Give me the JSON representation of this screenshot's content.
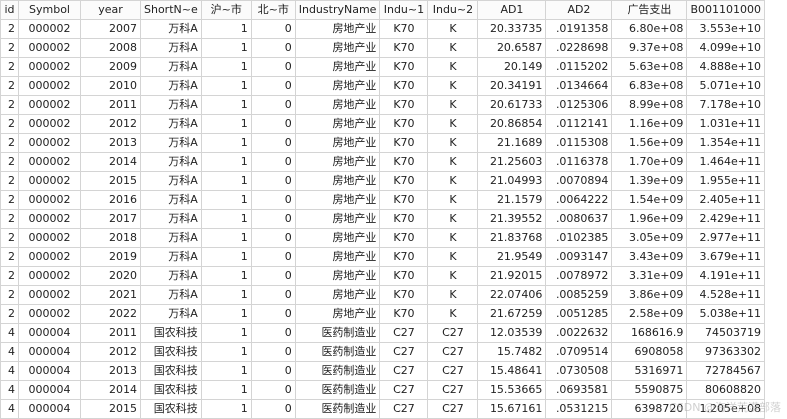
{
  "columns": [
    "id",
    "Symbol",
    "year",
    "ShortN~e",
    "沪~市",
    "北~市",
    "IndustryName",
    "Indu~1",
    "Indu~2",
    "AD1",
    "AD2",
    "广告支出",
    "B001101000"
  ],
  "rows": [
    [
      "2",
      "000002",
      "2007",
      "万科A",
      "1",
      "0",
      "房地产业",
      "K70",
      "K",
      "20.33735",
      ".0191358",
      "6.80e+08",
      "3.553e+10"
    ],
    [
      "2",
      "000002",
      "2008",
      "万科A",
      "1",
      "0",
      "房地产业",
      "K70",
      "K",
      "20.6587",
      ".0228698",
      "9.37e+08",
      "4.099e+10"
    ],
    [
      "2",
      "000002",
      "2009",
      "万科A",
      "1",
      "0",
      "房地产业",
      "K70",
      "K",
      "20.149",
      ".0115202",
      "5.63e+08",
      "4.888e+10"
    ],
    [
      "2",
      "000002",
      "2010",
      "万科A",
      "1",
      "0",
      "房地产业",
      "K70",
      "K",
      "20.34191",
      ".0134664",
      "6.83e+08",
      "5.071e+10"
    ],
    [
      "2",
      "000002",
      "2011",
      "万科A",
      "1",
      "0",
      "房地产业",
      "K70",
      "K",
      "20.61733",
      ".0125306",
      "8.99e+08",
      "7.178e+10"
    ],
    [
      "2",
      "000002",
      "2012",
      "万科A",
      "1",
      "0",
      "房地产业",
      "K70",
      "K",
      "20.86854",
      ".0112141",
      "1.16e+09",
      "1.031e+11"
    ],
    [
      "2",
      "000002",
      "2013",
      "万科A",
      "1",
      "0",
      "房地产业",
      "K70",
      "K",
      "21.1689",
      ".0115308",
      "1.56e+09",
      "1.354e+11"
    ],
    [
      "2",
      "000002",
      "2014",
      "万科A",
      "1",
      "0",
      "房地产业",
      "K70",
      "K",
      "21.25603",
      ".0116378",
      "1.70e+09",
      "1.464e+11"
    ],
    [
      "2",
      "000002",
      "2015",
      "万科A",
      "1",
      "0",
      "房地产业",
      "K70",
      "K",
      "21.04993",
      ".0070894",
      "1.39e+09",
      "1.955e+11"
    ],
    [
      "2",
      "000002",
      "2016",
      "万科A",
      "1",
      "0",
      "房地产业",
      "K70",
      "K",
      "21.1579",
      ".0064222",
      "1.54e+09",
      "2.405e+11"
    ],
    [
      "2",
      "000002",
      "2017",
      "万科A",
      "1",
      "0",
      "房地产业",
      "K70",
      "K",
      "21.39552",
      ".0080637",
      "1.96e+09",
      "2.429e+11"
    ],
    [
      "2",
      "000002",
      "2018",
      "万科A",
      "1",
      "0",
      "房地产业",
      "K70",
      "K",
      "21.83768",
      ".0102385",
      "3.05e+09",
      "2.977e+11"
    ],
    [
      "2",
      "000002",
      "2019",
      "万科A",
      "1",
      "0",
      "房地产业",
      "K70",
      "K",
      "21.9549",
      ".0093147",
      "3.43e+09",
      "3.679e+11"
    ],
    [
      "2",
      "000002",
      "2020",
      "万科A",
      "1",
      "0",
      "房地产业",
      "K70",
      "K",
      "21.92015",
      ".0078972",
      "3.31e+09",
      "4.191e+11"
    ],
    [
      "2",
      "000002",
      "2021",
      "万科A",
      "1",
      "0",
      "房地产业",
      "K70",
      "K",
      "22.07406",
      ".0085259",
      "3.86e+09",
      "4.528e+11"
    ],
    [
      "2",
      "000002",
      "2022",
      "万科A",
      "1",
      "0",
      "房地产业",
      "K70",
      "K",
      "21.67259",
      ".0051285",
      "2.58e+09",
      "5.038e+11"
    ],
    [
      "4",
      "000004",
      "2011",
      "国农科技",
      "1",
      "0",
      "医药制造业",
      "C27",
      "C27",
      "12.03539",
      ".0022632",
      "168616.9",
      "74503719"
    ],
    [
      "4",
      "000004",
      "2012",
      "国农科技",
      "1",
      "0",
      "医药制造业",
      "C27",
      "C27",
      "15.7482",
      ".0709514",
      "6908058",
      "97363302"
    ],
    [
      "4",
      "000004",
      "2013",
      "国农科技",
      "1",
      "0",
      "医药制造业",
      "C27",
      "C27",
      "15.48641",
      ".0730508",
      "5316971",
      "72784567"
    ],
    [
      "4",
      "000004",
      "2014",
      "国农科技",
      "1",
      "0",
      "医药制造业",
      "C27",
      "C27",
      "15.53665",
      ".0693581",
      "5590875",
      "80608820"
    ],
    [
      "4",
      "000004",
      "2015",
      "国农科技",
      "1",
      "0",
      "医药制造业",
      "C27",
      "C27",
      "15.67161",
      ".0531215",
      "6398720",
      "1.205e+08"
    ]
  ],
  "watermark": "CSDN @海洋荒漠部落"
}
